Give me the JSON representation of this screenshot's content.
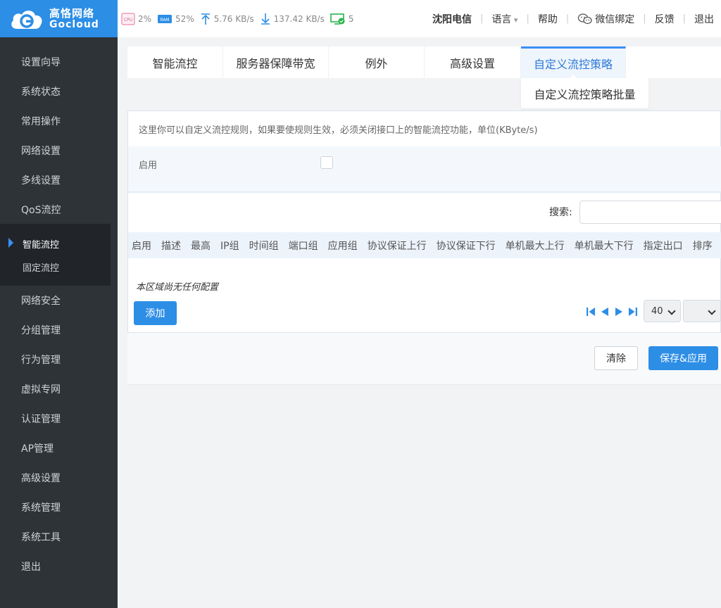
{
  "brand": {
    "name_cn": "高恪网络",
    "name_en": "Gocloud"
  },
  "stats": {
    "cpu_label": "CPU",
    "cpu": "2%",
    "ram_label": "RAM",
    "ram": "52%",
    "upload": "5.76 KB/s",
    "download": "137.42 KB/s",
    "devices": "5"
  },
  "toplinks": {
    "isp": "沈阳电信",
    "language": "语言",
    "help": "帮助",
    "wechat": "微信绑定",
    "feedback": "反馈",
    "logout": "退出"
  },
  "sidebar": {
    "items": [
      "设置向导",
      "系统状态",
      "常用操作",
      "网络设置",
      "多线设置",
      "QoS流控",
      "网络安全",
      "分组管理",
      "行为管理",
      "虚拟专网",
      "认证管理",
      "AP管理",
      "高级设置",
      "系统管理",
      "系统工具",
      "退出"
    ],
    "sub_items": [
      "智能流控",
      "固定流控"
    ]
  },
  "tabs": [
    "智能流控",
    "服务器保障带宽",
    "例外",
    "高级设置",
    "自定义流控策略"
  ],
  "dropdown_item": "自定义流控策略批量",
  "panel": {
    "description": "这里你可以自定义流控规则，如果要使规则生效，必须关闭接口上的智能流控功能，单位(KByte/s)",
    "enable_label": "启用",
    "search_label": "搜索:",
    "columns": [
      "启用",
      "描述",
      "最高",
      "IP组",
      "时间组",
      "端口组",
      "应用组",
      "协议保证上行",
      "协议保证下行",
      "单机最大上行",
      "单机最大下行",
      "指定出口",
      "排序"
    ],
    "empty_message": "本区域尚无任何配置",
    "add_label": "添加",
    "page_size": "40"
  },
  "actions": {
    "clear": "清除",
    "save": "保存&应用"
  },
  "colors": {
    "brand_blue": "#2d8ee6",
    "sidebar_bg": "#2e3338",
    "active_tab_text": "#2d7ad6"
  }
}
